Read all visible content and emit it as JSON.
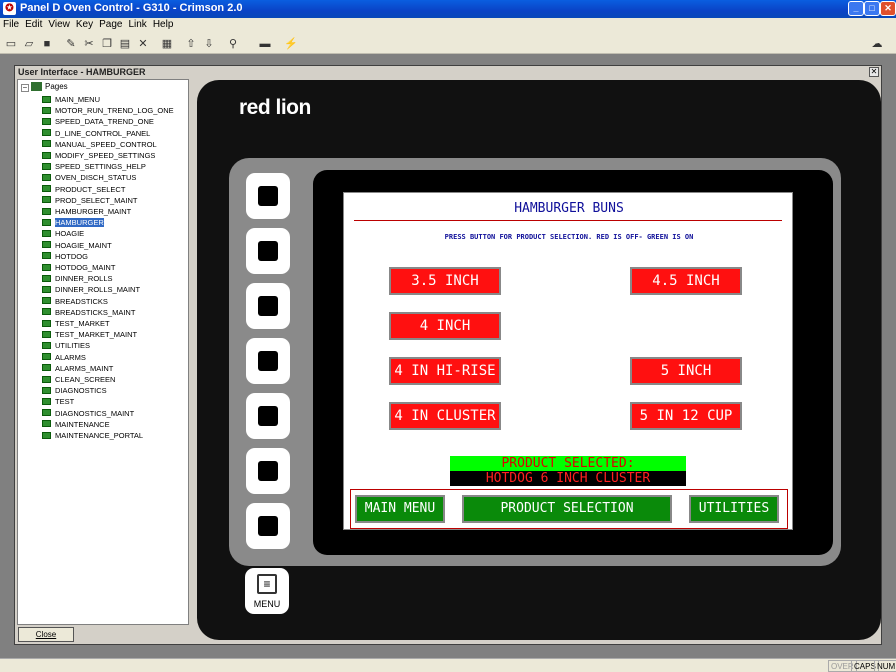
{
  "window": {
    "title": "Panel D Oven Control - G310 - Crimson 2.0"
  },
  "menu": [
    "File",
    "Edit",
    "View",
    "Key",
    "Page",
    "Link",
    "Help"
  ],
  "doc": {
    "title": "User Interface - HAMBURGER",
    "close_label": "Close"
  },
  "tree": {
    "root": "Pages",
    "items": [
      "MAIN_MENU",
      "MOTOR_RUN_TREND_LOG_ONE",
      "SPEED_DATA_TREND_ONE",
      "D_LINE_CONTROL_PANEL",
      "MANUAL_SPEED_CONTROL",
      "MODIFY_SPEED_SETTINGS",
      "SPEED_SETTINGS_HELP",
      "OVEN_DISCH_STATUS",
      "PRODUCT_SELECT",
      "PROD_SELECT_MAINT",
      "HAMBURGER_MAINT",
      "HAMBURGER",
      "HOAGIE",
      "HOAGIE_MAINT",
      "HOTDOG",
      "HOTDOG_MAINT",
      "DINNER_ROLLS",
      "DINNER_ROLLS_MAINT",
      "BREADSTICKS",
      "BREADSTICKS_MAINT",
      "TEST_MARKET",
      "TEST_MARKET_MAINT",
      "UTILITIES",
      "ALARMS",
      "ALARMS_MAINT",
      "CLEAN_SCREEN",
      "DIAGNOSTICS",
      "TEST",
      "DIAGNOSTICS_MAINT",
      "MAINTENANCE",
      "MAINTENANCE_PORTAL"
    ],
    "selected": "HAMBURGER"
  },
  "device": {
    "brand": "red lion",
    "menu_key_label": "MENU"
  },
  "hmi": {
    "title": "HAMBURGER BUNS",
    "instruction": "PRESS BUTTON FOR PRODUCT SELECTION. RED IS OFF- GREEN IS ON",
    "buttons": {
      "b35": "3.5 INCH",
      "b45": "4.5 INCH",
      "b4": "4 INCH",
      "b4hr": "4 IN HI-RISE",
      "b5": "5 INCH",
      "b4c": "4 IN CLUSTER",
      "b512": "5 IN 12 CUP"
    },
    "selected_label": "PRODUCT SELECTED:",
    "selected_value": "HOTDOG 6 INCH CLUSTER",
    "nav": {
      "main_menu": "MAIN MENU",
      "product_selection": "PRODUCT SELECTION",
      "utilities": "UTILITIES"
    }
  },
  "status": {
    "over": "OVER",
    "caps": "CAPS",
    "num": "NUM"
  },
  "colors": {
    "button_off": "#ff1010",
    "button_nav": "#0a8a0a",
    "selected_bg": "#00ff00"
  }
}
